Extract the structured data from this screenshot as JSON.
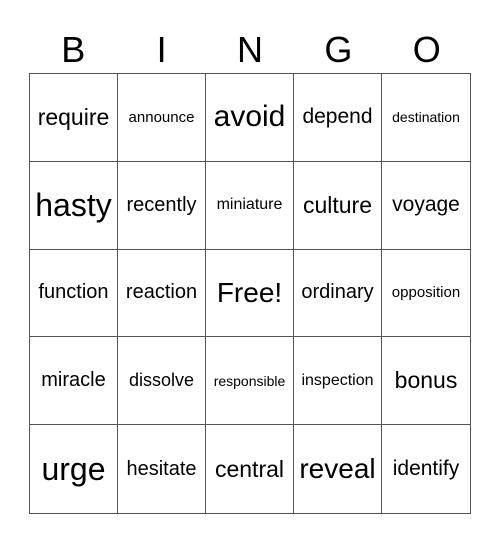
{
  "header": [
    "B",
    "I",
    "N",
    "G",
    "O"
  ],
  "cells": [
    [
      "require",
      "announce",
      "avoid",
      "depend",
      "destination"
    ],
    [
      "hasty",
      "recently",
      "miniature",
      "culture",
      "voyage"
    ],
    [
      "function",
      "reaction",
      "Free!",
      "ordinary",
      "opposition"
    ],
    [
      "miracle",
      "dissolve",
      "responsible",
      "inspection",
      "bonus"
    ],
    [
      "urge",
      "hesitate",
      "central",
      "reveal",
      "identify"
    ]
  ]
}
